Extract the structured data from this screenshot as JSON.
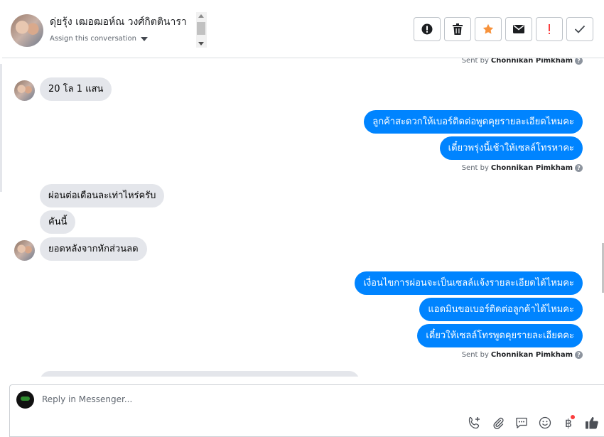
{
  "header": {
    "contact_name": "ดุ่ยรุ้ง เฒอฒอห์ณ วงศ์กิตตินารา",
    "assign_label": "Assign this conversation",
    "tools": [
      {
        "icon": "info-circle-icon",
        "color": "#1c1e21"
      },
      {
        "icon": "trash-icon",
        "color": "#1c1e21"
      },
      {
        "icon": "star-icon",
        "color": "#f7923b"
      },
      {
        "icon": "envelope-icon",
        "color": "#1c1e21"
      },
      {
        "icon": "exclamation-icon",
        "color": "#fa3e3e"
      },
      {
        "icon": "check-icon",
        "color": "#444950"
      }
    ]
  },
  "thread": {
    "sent_prefix": "Sent by",
    "sender": "Chonnikan Pimkham",
    "messages": {
      "in1": "20 โล 1 แสน",
      "out1": "ลูกค้าสะดวกให้เบอร์ติดต่อพูดคุยรายละเอียดไหมคะ",
      "out2": "เดี๋ยวพรุ่งนี้เช้าให้เซลล์โทรหาคะ",
      "in2": "ผ่อนต่อเดือนละเท่าไหร่ครับ",
      "in3": "คันนี้",
      "in4": "ยอดหลังจากหักส่วนลด",
      "out3": "เงื่อนไขการผ่อนจะเป็นเซลล์แจ้งรายละเอียดได้ไหมคะ",
      "out4": "แอดมินขอเบอร์ติดต่อลูกค้าได้ไหมคะ",
      "out5": "เดี๋ยวให้เซลล์โทรพูดคุยรายละเอียดคะ"
    }
  },
  "reply": {
    "placeholder": "Reply in Messenger...",
    "tools": [
      "add-call-icon",
      "attach-icon",
      "saved-reply-icon",
      "emoji-icon",
      "baht-icon",
      "thumbs-up-icon"
    ],
    "baht_symbol": "฿"
  },
  "colors": {
    "accent": "#0084ff",
    "incoming": "#e4e6eb"
  }
}
